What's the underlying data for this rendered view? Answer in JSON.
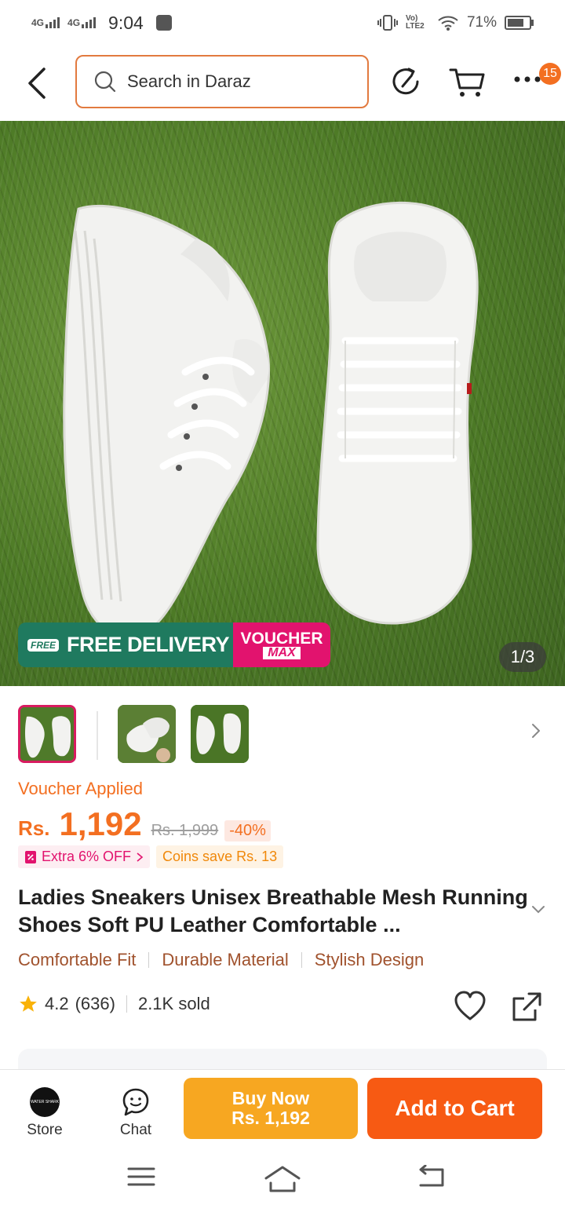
{
  "status_bar": {
    "net1": "4G",
    "net2": "4G",
    "time": "9:04",
    "volte": "Vo) LTE2",
    "battery": "71%"
  },
  "top_nav": {
    "search_placeholder": "Search in Daraz",
    "cart_badge": "15",
    "icons": [
      "back-icon",
      "search-icon",
      "history-icon",
      "cart-icon",
      "more-icon"
    ]
  },
  "hero": {
    "promo_free_tag": "FREE",
    "promo_text": "FREE DELIVERY",
    "voucher_text": "VOUCHER",
    "voucher_max": "MAX",
    "counter": "1/3"
  },
  "product": {
    "voucher_applied": "Voucher Applied",
    "price_prefix": "Rs.",
    "price": "1,192",
    "old_price": "Rs. 1,999",
    "discount": "-40%",
    "extra_off": "Extra 6% OFF",
    "coins_save": "Coins save Rs. 13",
    "title": "Ladies Sneakers Unisex Breathable Mesh Running Shoes Soft PU Leather Comfortable ...",
    "features": [
      "Comfortable Fit",
      "Durable Material",
      "Stylish Design"
    ],
    "rating": "4.2",
    "rating_count": "(636)",
    "sold": "2.1K sold"
  },
  "actions": {
    "store_label": "Store",
    "store_logo_text": "WATER SHARK",
    "chat_label": "Chat",
    "buy_now_label": "Buy Now",
    "buy_now_price": "Rs. 1,192",
    "add_cart_label": "Add to Cart"
  },
  "colors": {
    "accent": "#f36f21",
    "buy_now": "#f7a721",
    "add_to_cart": "#f75a13",
    "delivery_green": "#1f7a5f",
    "voucher_pink": "#e2136e"
  }
}
